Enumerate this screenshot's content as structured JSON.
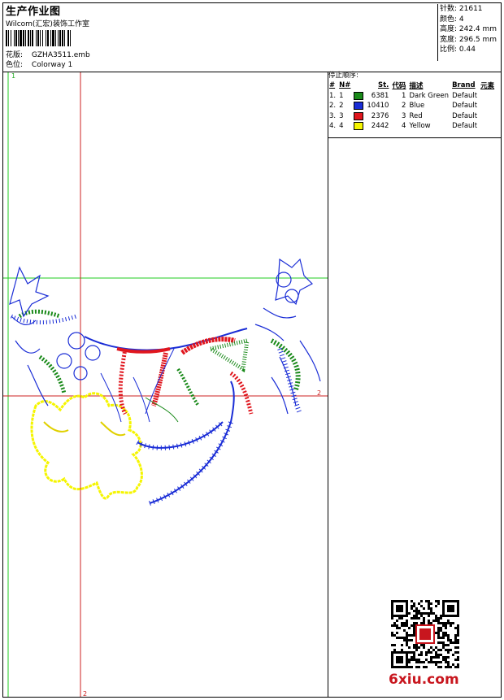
{
  "header": {
    "title": "生产作业图",
    "company": "Wilcom(汇宏)装饰工作室",
    "design_label": "花版:",
    "design_file": "GZHA3511.emb",
    "colorway_label": "色位:",
    "colorway": "Colorway 1"
  },
  "stats": {
    "stitches": "针数: 21611",
    "colors": "颜色: 4",
    "height": "高度: 242.4 mm",
    "width": "宽度: 296.5 mm",
    "scale": "比例: 0.44"
  },
  "stop_sequence": {
    "title": "停止顺序:",
    "headers": [
      "#",
      "N#",
      "St.",
      "代码",
      "描述",
      "Brand",
      "元素"
    ],
    "rows": [
      {
        "num": "1.",
        "n": "1",
        "color": "#1a8a1a",
        "st": "6381",
        "code": "1",
        "desc": "Dark Green",
        "brand": "Default"
      },
      {
        "num": "2.",
        "n": "2",
        "color": "#1a2dd6",
        "st": "10410",
        "code": "2",
        "desc": "Blue",
        "brand": "Default"
      },
      {
        "num": "3.",
        "n": "3",
        "color": "#e0161e",
        "st": "2376",
        "code": "3",
        "desc": "Red",
        "brand": "Default"
      },
      {
        "num": "4.",
        "n": "4",
        "color": "#f5f500",
        "st": "2442",
        "code": "4",
        "desc": "Yellow",
        "brand": "Default"
      }
    ]
  },
  "guides": {
    "marker_1_top": "1",
    "marker_2_right": "2",
    "marker_2_bottom": "2"
  },
  "watermark": "6xiu.com",
  "colors": {
    "green": "#1a8a1a",
    "blue": "#1a2dd6",
    "red": "#e0161e",
    "yellow": "#f5f500",
    "guide_green": "#22cc22",
    "guide_red": "#cc2222"
  }
}
